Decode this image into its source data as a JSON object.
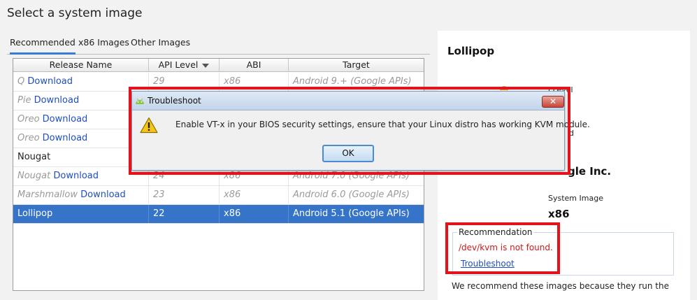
{
  "page": {
    "title": "Select a system image"
  },
  "tabs": [
    {
      "label": "Recommended",
      "active": true
    },
    {
      "label": "x86 Images",
      "active": false
    },
    {
      "label": "Other Images",
      "active": false
    }
  ],
  "table": {
    "columns": [
      "Release Name",
      "API Level",
      "ABI",
      "Target"
    ],
    "rows": [
      {
        "name": "Q",
        "action": "Download",
        "api": "29",
        "abi": "x86",
        "target": "Android 9.+ (Google APIs)"
      },
      {
        "name": "Pie",
        "action": "Download",
        "api": "",
        "abi": "",
        "target": ""
      },
      {
        "name": "Oreo",
        "action": "Download",
        "api": "",
        "abi": "",
        "target": ""
      },
      {
        "name": "Oreo",
        "action": "Download",
        "api": "",
        "abi": "",
        "target": ""
      },
      {
        "name": "Nougat",
        "action": "",
        "api": "",
        "abi": "",
        "target": ""
      },
      {
        "name": "Nougat",
        "action": "Download",
        "api": "24",
        "abi": "x86",
        "target": "Android 7.0 (Google APIs)"
      },
      {
        "name": "Marshmallow",
        "action": "Download",
        "api": "23",
        "abi": "x86",
        "target": "Android 6.0 (Google APIs)"
      },
      {
        "name": "Lollipop",
        "action": "",
        "api": "22",
        "abi": "x86",
        "target": "Android 5.1 (Google APIs)"
      }
    ]
  },
  "right_panel": {
    "title": "Lollipop",
    "fragment_1": "l Level",
    "fragment_2": "d",
    "vendor": "gle Inc.",
    "system_image_label": "System Image",
    "system_image_value": "x86",
    "recommendation": {
      "legend": "Recommendation",
      "error": "/dev/kvm is not found.",
      "link": "Troubleshoot"
    },
    "description": "We recommend these images because they run the"
  },
  "dialog": {
    "title": "Troubleshoot",
    "message": "Enable VT-x in your BIOS security settings, ensure that your Linux distro has working KVM module.",
    "ok_label": "OK",
    "close_glyph": "✕"
  },
  "colors": {
    "selection": "#3574c8",
    "link": "#1f4fc0",
    "error": "#d01818",
    "highlight_box": "#e3131b"
  }
}
